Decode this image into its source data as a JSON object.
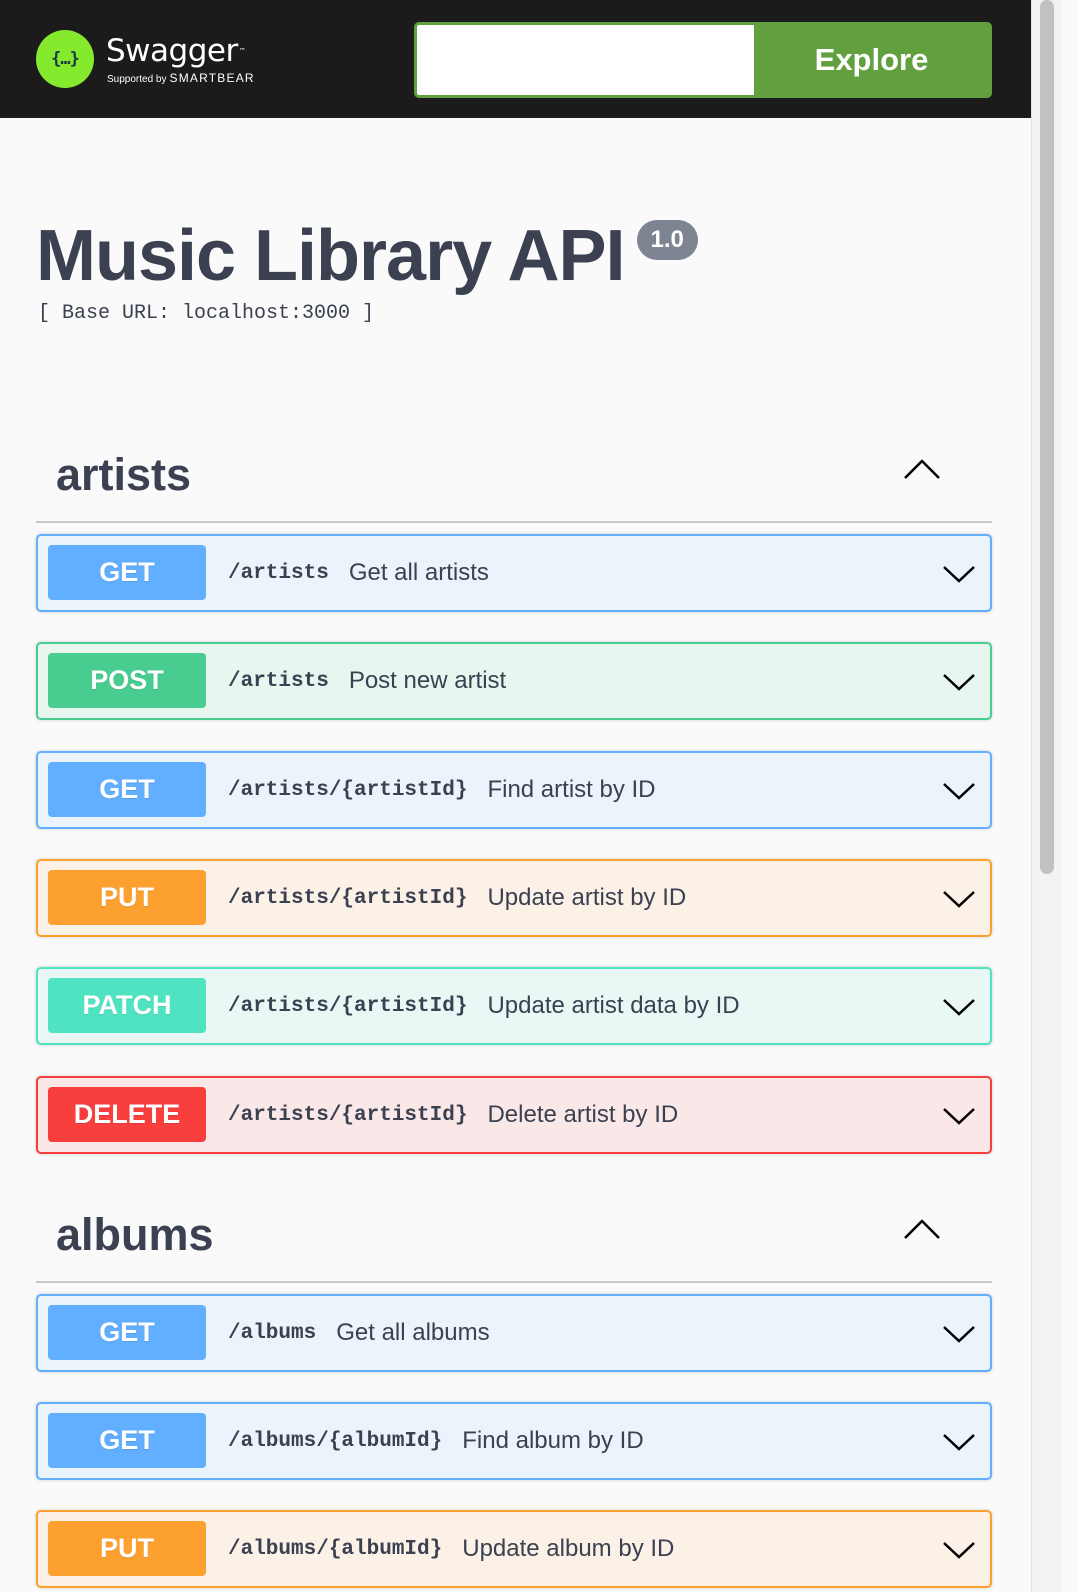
{
  "brand": {
    "logo_glyph": "{…}",
    "name": "Swagger",
    "trademark": "™",
    "supported_by": "Supported by",
    "company": "SMARTBEAR",
    "accent_color": "#85ea2d"
  },
  "search": {
    "value": "",
    "placeholder": "",
    "button_label": "Explore"
  },
  "info": {
    "title": "Music Library API",
    "version": "1.0",
    "base_url": "[ Base URL: localhost:3000 ]"
  },
  "tags": [
    {
      "name": "artists",
      "operations": [
        {
          "method": "GET",
          "path": "/artists",
          "summary": "Get all artists"
        },
        {
          "method": "POST",
          "path": "/artists",
          "summary": "Post new artist"
        },
        {
          "method": "GET",
          "path": "/artists/{artistId}",
          "summary": "Find artist by ID"
        },
        {
          "method": "PUT",
          "path": "/artists/{artistId}",
          "summary": "Update artist by ID"
        },
        {
          "method": "PATCH",
          "path": "/artists/{artistId}",
          "summary": "Update artist data by ID"
        },
        {
          "method": "DELETE",
          "path": "/artists/{artistId}",
          "summary": "Delete artist by ID"
        }
      ]
    },
    {
      "name": "albums",
      "operations": [
        {
          "method": "GET",
          "path": "/albums",
          "summary": "Get all albums"
        },
        {
          "method": "GET",
          "path": "/albums/{albumId}",
          "summary": "Find album by ID"
        },
        {
          "method": "PUT",
          "path": "/albums/{albumId}",
          "summary": "Update album by ID"
        }
      ]
    }
  ],
  "method_colors": {
    "GET": "#61affe",
    "POST": "#49cc90",
    "PUT": "#fca130",
    "PATCH": "#50e3c2",
    "DELETE": "#f93e3e"
  }
}
